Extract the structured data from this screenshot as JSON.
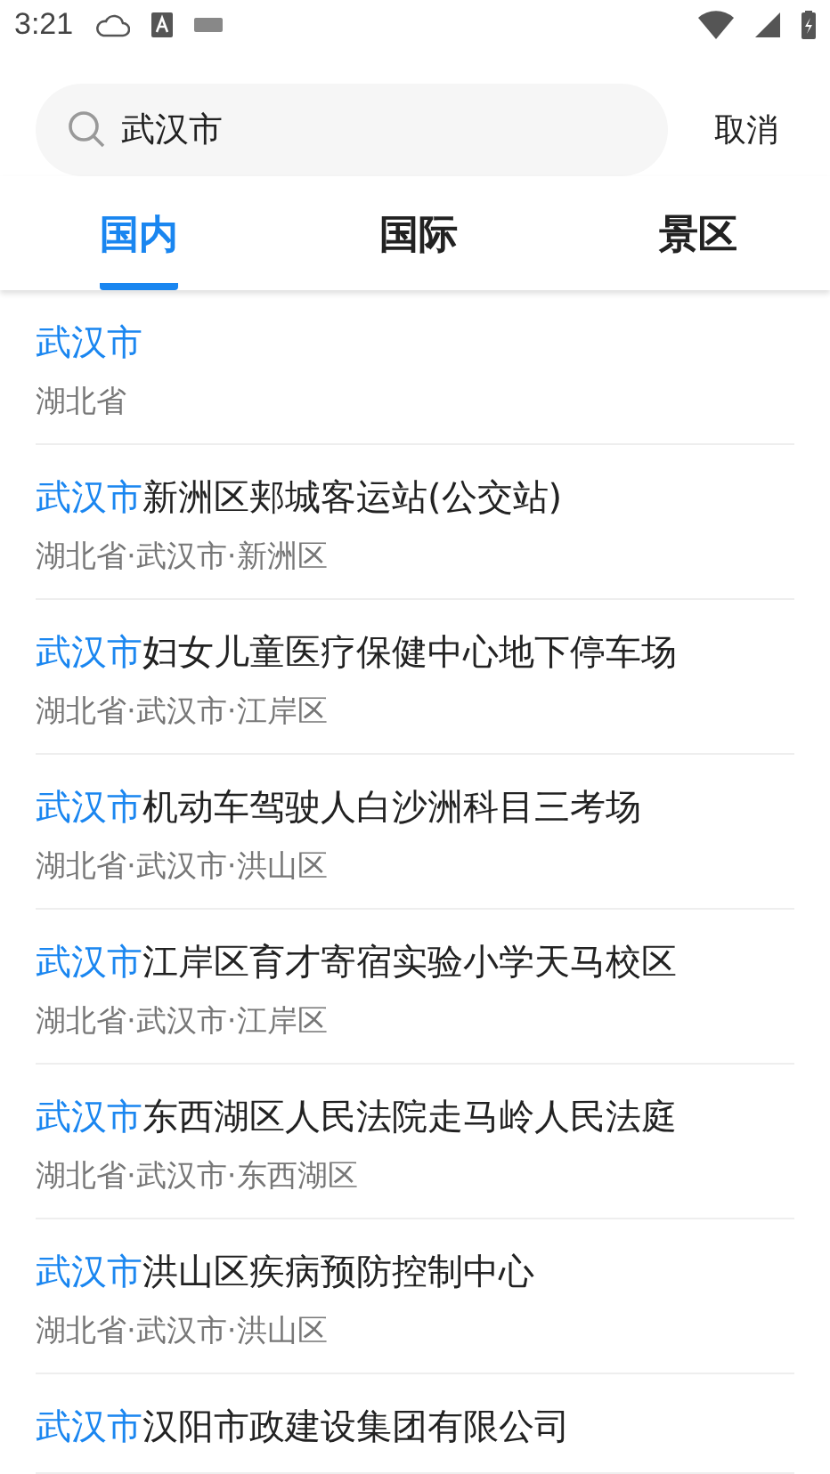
{
  "status_bar": {
    "time": "3:21"
  },
  "search": {
    "value": "武汉市",
    "cancel": "取消"
  },
  "tabs": [
    {
      "label": "国内",
      "selected": true
    },
    {
      "label": "国际",
      "selected": false
    },
    {
      "label": "景区",
      "selected": false
    }
  ],
  "results": [
    {
      "match": "武汉市",
      "region": "湖北省"
    },
    {
      "match": "武汉市",
      "rest": "新洲区郏城客运站(公交站)",
      "region": "湖北省·武汉市·新洲区"
    },
    {
      "match": "武汉市",
      "rest": "妇女儿童医疗保健中心地下停车场",
      "region": "湖北省·武汉市·江岸区"
    },
    {
      "match": "武汉市",
      "rest": "机动车驾驶人白沙洲科目三考场",
      "region": "湖北省·武汉市·洪山区"
    },
    {
      "match": "武汉市",
      "rest": "江岸区育才寄宿实验小学天马校区",
      "region": "湖北省·武汉市·江岸区"
    },
    {
      "match": "武汉市",
      "rest": "东西湖区人民法院走马岭人民法庭",
      "region": "湖北省·武汉市·东西湖区"
    },
    {
      "match": "武汉市",
      "rest": "洪山区疾病预防控制中心",
      "region": "湖北省·武汉市·洪山区"
    },
    {
      "match": "武汉市",
      "rest": "汉阳市政建设集团有限公司"
    }
  ]
}
